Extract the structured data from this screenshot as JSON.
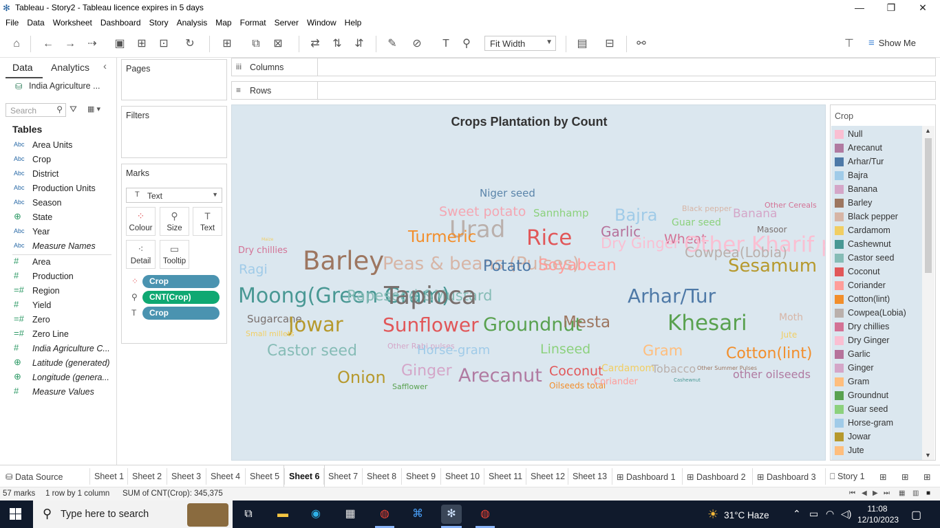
{
  "window": {
    "title": "Tableau - Story2 - Tableau licence expires in 5 days",
    "minimize": "—",
    "restore": "❐",
    "close": "✕"
  },
  "menu": [
    "File",
    "Data",
    "Worksheet",
    "Dashboard",
    "Story",
    "Analysis",
    "Map",
    "Format",
    "Server",
    "Window",
    "Help"
  ],
  "toolbar": {
    "fit_label": "Fit Width",
    "show_me_label": "Show Me"
  },
  "data_pane": {
    "tab_data": "Data",
    "tab_analytics": "Analytics",
    "datasource": "India Agriculture ...",
    "search_placeholder": "Search",
    "tables_heading": "Tables",
    "dimensions": [
      {
        "type": "Abc",
        "name": "Area Units"
      },
      {
        "type": "Abc",
        "name": "Crop"
      },
      {
        "type": "Abc",
        "name": "District"
      },
      {
        "type": "Abc",
        "name": "Production Units"
      },
      {
        "type": "Abc",
        "name": "Season"
      },
      {
        "type": "⊕",
        "name": "State"
      },
      {
        "type": "Abc",
        "name": "Year"
      },
      {
        "type": "Abc",
        "name": "Measure Names"
      }
    ],
    "measures": [
      {
        "type": "#",
        "name": "Area"
      },
      {
        "type": "#",
        "name": "Production"
      },
      {
        "type": "=#",
        "name": "Region"
      },
      {
        "type": "#",
        "name": "Yield"
      },
      {
        "type": "=#",
        "name": "Zero"
      },
      {
        "type": "=#",
        "name": "Zero Line"
      },
      {
        "type": "#",
        "name": "India Agriculture C..."
      },
      {
        "type": "⊕",
        "name": "Latitude (generated)"
      },
      {
        "type": "⊕",
        "name": "Longitude (genera..."
      },
      {
        "type": "#",
        "name": "Measure Values"
      }
    ]
  },
  "shelves": {
    "pages": "Pages",
    "filters": "Filters",
    "marks": "Marks",
    "columns": "Columns",
    "rows": "Rows",
    "mark_type": "Text",
    "mark_buttons": [
      "Colour",
      "Size",
      "Text",
      "Detail",
      "Tooltip"
    ],
    "pills": [
      "Crop",
      "CNT(Crop)",
      "Crop"
    ]
  },
  "viz": {
    "title": "Crops Plantation by Count",
    "words": [
      {
        "text": "Niger seed",
        "color": "#5b85aa"
      },
      {
        "text": "Black pepper",
        "color": "#d7b5a6"
      },
      {
        "text": "Other Cereals",
        "color": "#d37295"
      },
      {
        "text": "Sweet potato",
        "color": "#f4a6b2"
      },
      {
        "text": "Sannhamp",
        "color": "#8cd17d"
      },
      {
        "text": "Bajra",
        "color": "#a0cbe8"
      },
      {
        "text": "Guar seed",
        "color": "#8cd17d"
      },
      {
        "text": "Banana",
        "color": "#d4a6c8"
      },
      {
        "text": "Masoor",
        "color": "#79706e"
      },
      {
        "text": "Rice",
        "color": "#e15759"
      },
      {
        "text": "Garlic",
        "color": "#b6729b"
      },
      {
        "text": "Wheat",
        "color": "#d37295"
      },
      {
        "text": "Urad",
        "color": "#bab0ac"
      },
      {
        "text": "Turmeric",
        "color": "#f28e2b"
      },
      {
        "text": "Other Kharif pulses",
        "color": "#fabfd2"
      },
      {
        "text": "Dry Ginger",
        "color": "#fabfd2"
      },
      {
        "text": "Cowpea(Lobia)",
        "color": "#bab0ac"
      },
      {
        "text": "Maize",
        "color": "#f1ce63"
      },
      {
        "text": "Dry chillies",
        "color": "#d37295"
      },
      {
        "text": "Barley",
        "color": "#9d7660"
      },
      {
        "text": "Peas & beans (Pulses)",
        "color": "#d7b5a6"
      },
      {
        "text": "Potato",
        "color": "#4e79a7"
      },
      {
        "text": "Soyabean",
        "color": "#ff9d9a"
      },
      {
        "text": "Sesamum",
        "color": "#b6992d"
      },
      {
        "text": "Ragi",
        "color": "#a0cbe8"
      },
      {
        "text": "Moong(Green Gram)",
        "color": "#499894"
      },
      {
        "text": "Rapeseed &Mustard",
        "color": "#86bcb6"
      },
      {
        "text": "Tapioca",
        "color": "#79706e"
      },
      {
        "text": "Arhar/Tur",
        "color": "#4e79a7"
      },
      {
        "text": "Sugarcane",
        "color": "#79706e"
      },
      {
        "text": "Jowar",
        "color": "#b6992d"
      },
      {
        "text": "Sunflower",
        "color": "#e15759"
      },
      {
        "text": "Groundnut",
        "color": "#59a14f"
      },
      {
        "text": "Mesta",
        "color": "#9d7660"
      },
      {
        "text": "Khesari",
        "color": "#59a14f"
      },
      {
        "text": "Moth",
        "color": "#d7b5a6"
      },
      {
        "text": "Jute",
        "color": "#f1ce63"
      },
      {
        "text": "Small millets",
        "color": "#f1ce63"
      },
      {
        "text": "Other Rabi pulses",
        "color": "#d4a6c8"
      },
      {
        "text": "Castor seed",
        "color": "#86bcb6"
      },
      {
        "text": "Horse-gram",
        "color": "#a0cbe8"
      },
      {
        "text": "Linseed",
        "color": "#8cd17d"
      },
      {
        "text": "Gram",
        "color": "#ffbe7d"
      },
      {
        "text": "Cotton(lint)",
        "color": "#f28e2b"
      },
      {
        "text": "Onion",
        "color": "#b6992d"
      },
      {
        "text": "Ginger",
        "color": "#d4a6c8"
      },
      {
        "text": "Arecanut",
        "color": "#b07aa1"
      },
      {
        "text": "Coconut",
        "color": "#e15759"
      },
      {
        "text": "Cardamom",
        "color": "#f1ce63"
      },
      {
        "text": "Tobacco",
        "color": "#bab0ac"
      },
      {
        "text": "Other Summer Pulses",
        "color": "#9d7660"
      },
      {
        "text": "other oilseeds",
        "color": "#b07aa1"
      },
      {
        "text": "Cashewnut",
        "color": "#499894"
      },
      {
        "text": "Safflower",
        "color": "#59a14f"
      },
      {
        "text": "Oilseeds total",
        "color": "#f28e2b"
      },
      {
        "text": "Coriander",
        "color": "#ff9d9a"
      }
    ]
  },
  "legend": {
    "title": "Crop",
    "items": [
      {
        "name": "Null",
        "color": "#fabfd2"
      },
      {
        "name": "Arecanut",
        "color": "#b07aa1"
      },
      {
        "name": "Arhar/Tur",
        "color": "#4e79a7"
      },
      {
        "name": "Bajra",
        "color": "#a0cbe8"
      },
      {
        "name": "Banana",
        "color": "#d4a6c8"
      },
      {
        "name": "Barley",
        "color": "#9d7660"
      },
      {
        "name": "Black pepper",
        "color": "#d7b5a6"
      },
      {
        "name": "Cardamom",
        "color": "#f1ce63"
      },
      {
        "name": "Cashewnut",
        "color": "#499894"
      },
      {
        "name": "Castor seed",
        "color": "#86bcb6"
      },
      {
        "name": "Coconut",
        "color": "#e15759"
      },
      {
        "name": "Coriander",
        "color": "#ff9d9a"
      },
      {
        "name": "Cotton(lint)",
        "color": "#f28e2b"
      },
      {
        "name": "Cowpea(Lobia)",
        "color": "#bab0ac"
      },
      {
        "name": "Dry chillies",
        "color": "#d37295"
      },
      {
        "name": "Dry Ginger",
        "color": "#fabfd2"
      },
      {
        "name": "Garlic",
        "color": "#b6729b"
      },
      {
        "name": "Ginger",
        "color": "#d4a6c8"
      },
      {
        "name": "Gram",
        "color": "#ffbe7d"
      },
      {
        "name": "Groundnut",
        "color": "#59a14f"
      },
      {
        "name": "Guar seed",
        "color": "#8cd17d"
      },
      {
        "name": "Horse-gram",
        "color": "#a0cbe8"
      },
      {
        "name": "Jowar",
        "color": "#b6992d"
      },
      {
        "name": "Jute",
        "color": "#ffbe7d"
      }
    ]
  },
  "sheet_tabs": {
    "datasource": "Data Source",
    "tabs": [
      "Sheet 1",
      "Sheet 2",
      "Sheet 3",
      "Sheet 4",
      "Sheet 5",
      "Sheet 6",
      "Sheet 7",
      "Sheet 8",
      "Sheet 9",
      "Sheet 10",
      "Sheet 11",
      "Sheet 12",
      "Sheet 13",
      "Dashboard 1",
      "Dashboard 2",
      "Dashboard 3",
      "Story 1"
    ],
    "active": "Sheet 6"
  },
  "status": {
    "marks": "57 marks",
    "rows": "1 row by 1 column",
    "sum": "SUM of CNT(Crop): 345,375"
  },
  "taskbar": {
    "search_placeholder": "Type here to search",
    "weather": "31°C  Haze",
    "time": "11:08",
    "date": "12/10/2023"
  }
}
